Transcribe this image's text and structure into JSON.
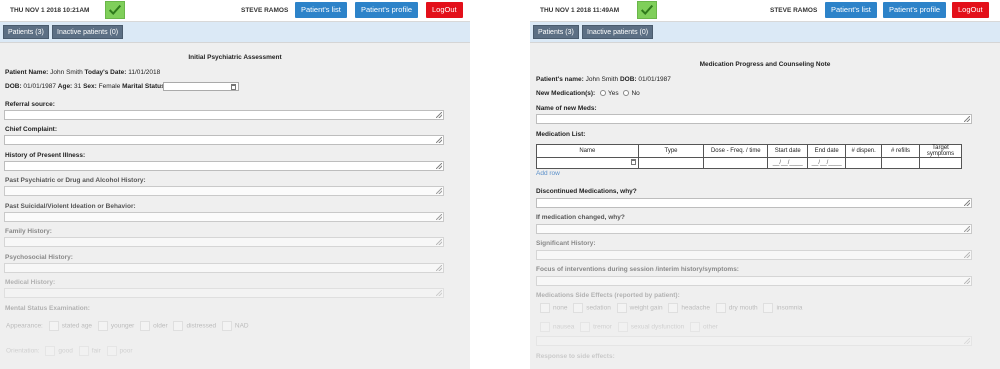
{
  "left": {
    "datetime": "THU NOV 1 2018 10:21AM",
    "user": "STEVE RAMOS",
    "btn_patients": "Patient's list",
    "btn_profile": "Patient's profile",
    "btn_logout": "LogOut",
    "tab_patients": "Patients (3)",
    "tab_inactive": "Inactive patients (0)",
    "title": "Initial Psychiatric Assessment",
    "patient_label": "Patient Name:",
    "patient_value": "John Smith",
    "date_label": "Today's Date:",
    "date_value": "11/01/2018",
    "dob_label": "DOB:",
    "dob_value": "01/01/1987",
    "age_label": "Age:",
    "age_value": "31",
    "sex_label": "Sex:",
    "sex_value": "Female",
    "marital_label": "Marital Status:",
    "sections": [
      "Referral source:",
      "Chief Complaint:",
      "History of Present Illness:",
      "Past Psychiatric or Drug and Alcohol History:",
      "Past Suicidal/Violent Ideation or Behavior:",
      "Family History:",
      "Psychosocial History:",
      "Medical History:"
    ],
    "mse_label": "Mental Status Examination:",
    "appearance_label": "Appearance:",
    "appearance_opts": [
      "stated age",
      "younger",
      "older",
      "distressed",
      "NAD"
    ],
    "orientation_label": "Orientation:",
    "orientation_opts": [
      "good",
      "fair",
      "poor"
    ]
  },
  "right": {
    "datetime": "THU NOV 1 2018 11:49AM",
    "user": "STEVE RAMOS",
    "btn_patients": "Patient's list",
    "btn_profile": "Patient's profile",
    "btn_logout": "LogOut",
    "tab_patients": "Patients (3)",
    "tab_inactive": "Inactive patients (0)",
    "title": "Medication Progress and Counseling Note",
    "patient_label": "Patient's name:",
    "patient_value": "John Smith",
    "dob_label": "DOB:",
    "dob_value": "01/01/1987",
    "new_med_label": "New Medication(s):",
    "yes": "Yes",
    "no": "No",
    "name_new_meds": "Name of new Meds:",
    "med_list_label": "Medication List:",
    "table_headers": [
      "Name",
      "Type",
      "Dose - Freq. / time",
      "Start date",
      "End date",
      "# dispen.",
      "# refills",
      "Target symptoms"
    ],
    "date_placeholder": "__/__/____",
    "add_row": "Add row",
    "discontinued": "Discontinued Medications, why?",
    "changed": "If medication changed, why?",
    "significant": "Significant History:",
    "focus": "Focus of interventions during session /interim history/symptoms:",
    "side_effects": "Medications Side Effects (reported by patient):",
    "side_row1": [
      "none",
      "sedation",
      "weight gain",
      "headache",
      "dry mouth",
      "insomnia"
    ],
    "side_row2": [
      "nausea",
      "tremor",
      "sexual dysfunction",
      "other"
    ],
    "response": "Response to side effects:"
  }
}
